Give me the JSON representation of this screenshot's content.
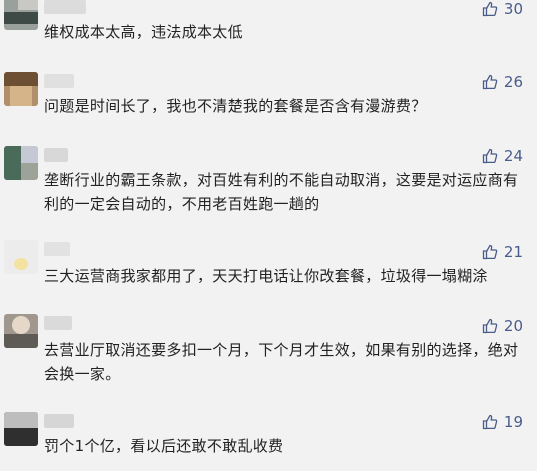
{
  "comments": [
    {
      "likes": "30",
      "text": "维权成本太高，违法成本太低"
    },
    {
      "likes": "26",
      "text": "问题是时间长了，我也不清楚我的套餐是否含有漫游费？"
    },
    {
      "likes": "24",
      "text": "垄断行业的霸王条款，对百姓有利的不能自动取消，这要是对运应商有利的一定会自动的，不用老百姓跑一趟的"
    },
    {
      "likes": "21",
      "text": "三大运营商我家都用了，天天打电话让你改套餐，垃圾得一塌糊涂"
    },
    {
      "likes": "20",
      "text": "去营业厅取消还要多扣一个月，下个月才生效，如果有别的选择，绝对会换一家。"
    },
    {
      "likes": "19",
      "text": "罚个1个亿，看以后还敢不敢乱收费"
    }
  ],
  "colors": {
    "background": "#f2f2f2",
    "like": "#4a5c8a",
    "text": "#222222"
  },
  "icons": {
    "like": "thumbs-up-icon"
  }
}
